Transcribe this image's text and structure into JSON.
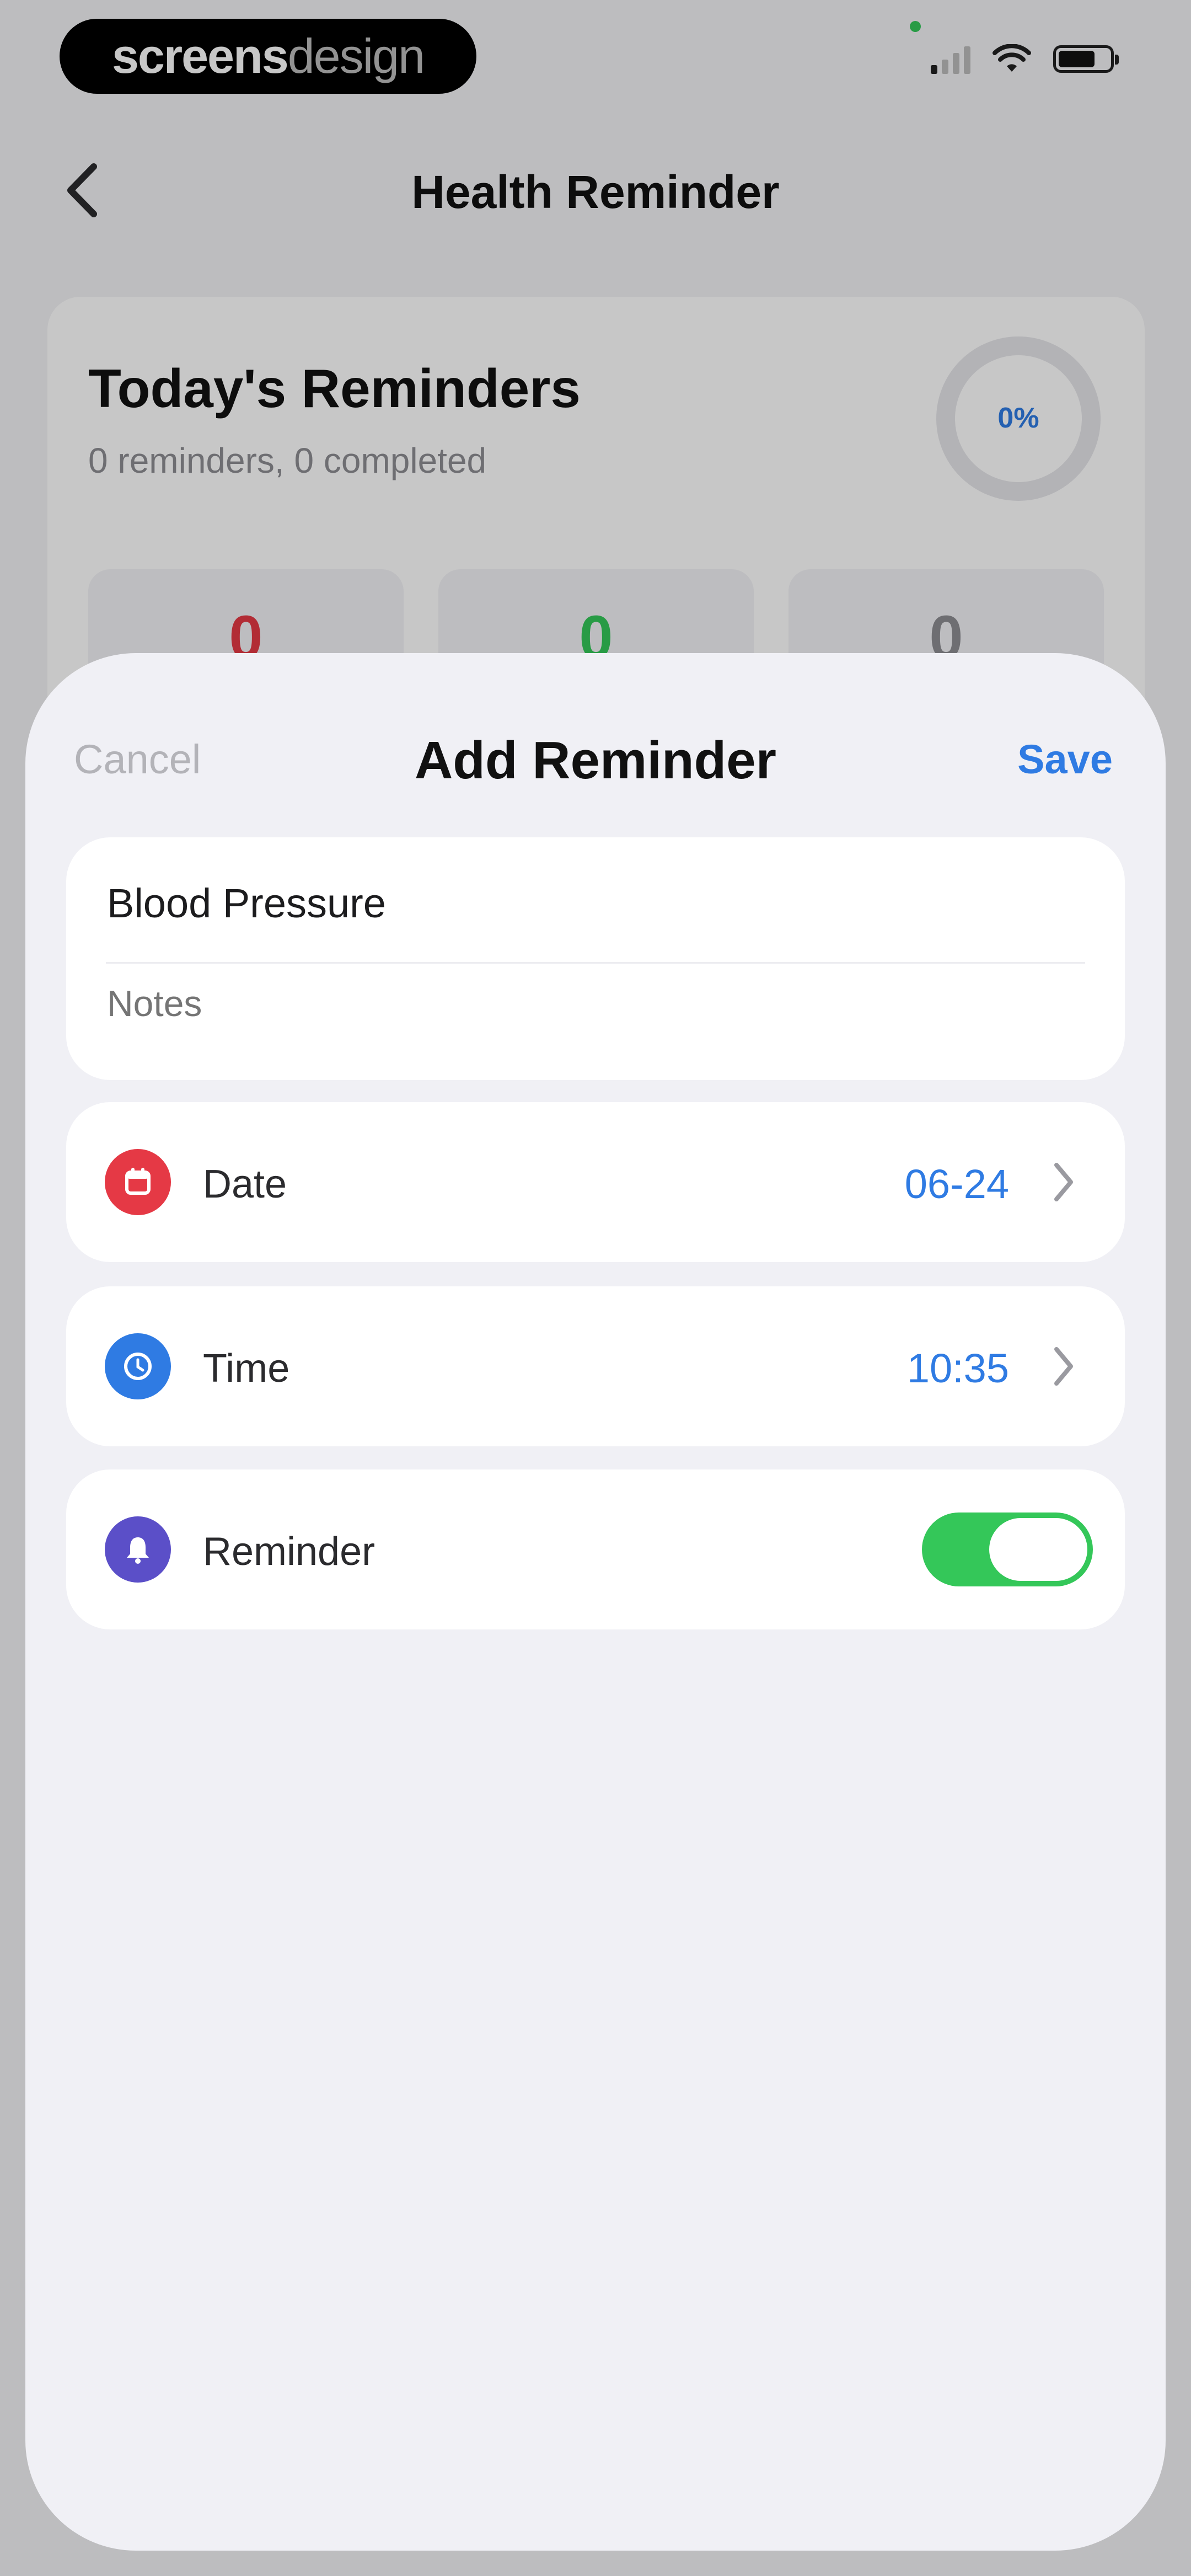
{
  "status_bar": {
    "watermark_part1": "screens",
    "watermark_part2": "design",
    "signal_icon": "signal-icon",
    "wifi_icon": "wifi-icon",
    "battery_icon": "battery-icon"
  },
  "nav": {
    "back_icon": "chevron-left-icon",
    "title": "Health Reminder"
  },
  "summary": {
    "title": "Today's Reminders",
    "subtitle": "0 reminders, 0 completed",
    "progress_label": "0%",
    "progress_fraction": 0,
    "stats": [
      {
        "value": "0",
        "color": "#e53945"
      },
      {
        "value": "0",
        "color": "#34c759"
      },
      {
        "value": "0",
        "color": "#8e8e93"
      }
    ]
  },
  "sheet": {
    "cancel_label": "Cancel",
    "title": "Add Reminder",
    "save_label": "Save",
    "title_field_value": "Blood Pressure",
    "notes_placeholder": "Notes",
    "rows": {
      "date": {
        "label": "Date",
        "value": "06-24",
        "icon": "calendar-icon",
        "icon_color": "#e53945"
      },
      "time": {
        "label": "Time",
        "value": "10:35",
        "icon": "clock-icon",
        "icon_color": "#2f7be3"
      },
      "reminder": {
        "label": "Reminder",
        "icon": "bell-icon",
        "icon_color": "#5b4fc8",
        "enabled": true
      }
    }
  },
  "colors": {
    "accent": "#2f7be3",
    "toggle_on": "#34c759"
  }
}
